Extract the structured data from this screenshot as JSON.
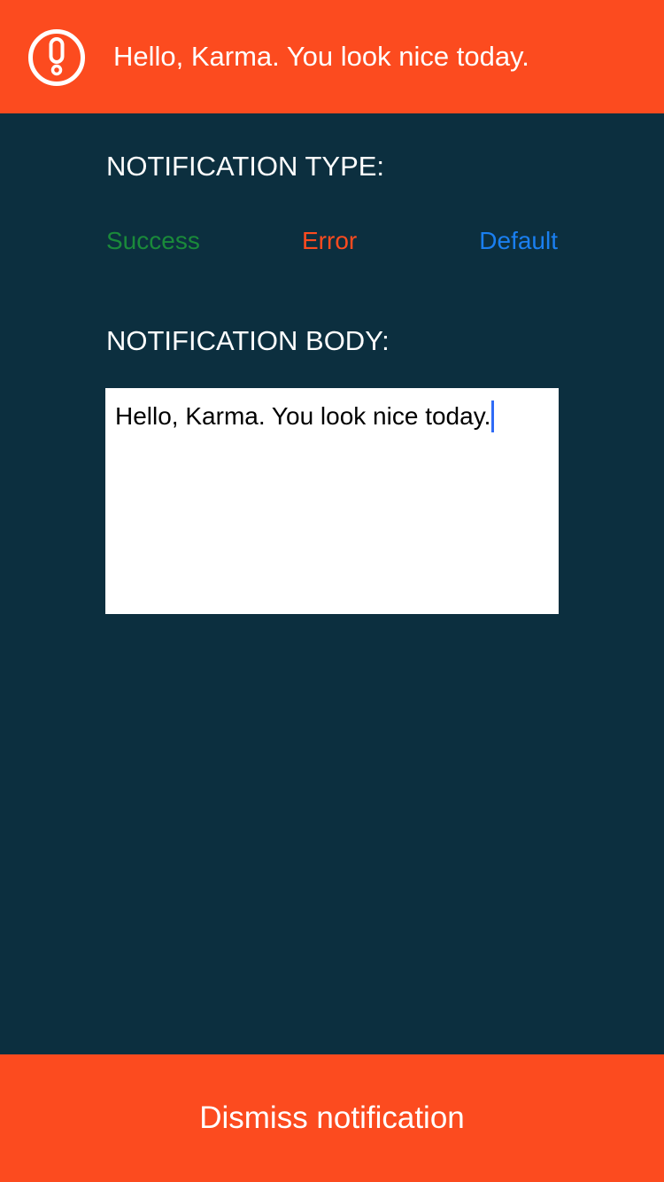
{
  "banner": {
    "message": "Hello, Karma. You look nice today.",
    "icon": "alert-icon",
    "color": "#fc4b1f"
  },
  "notification_type": {
    "label": "NOTIFICATION TYPE:",
    "options": [
      {
        "label": "Success",
        "color": "#1a8a3a"
      },
      {
        "label": "Error",
        "color": "#fc4b1f"
      },
      {
        "label": "Default",
        "color": "#1a7ff0"
      }
    ]
  },
  "notification_body": {
    "label": "NOTIFICATION BODY:",
    "value": "Hello, Karma. You look nice today."
  },
  "dismiss": {
    "label": "Dismiss notification"
  },
  "colors": {
    "background": "#0c2f3f",
    "accent": "#fc4b1f",
    "caret": "#2f6bf6"
  }
}
